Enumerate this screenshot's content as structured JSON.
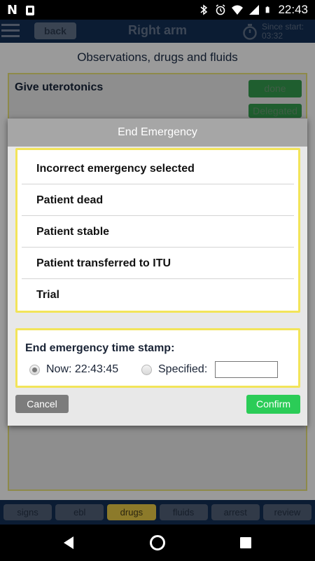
{
  "status_bar": {
    "left_icons": [
      "n-logo-icon",
      "phone-notification-icon"
    ],
    "right_icons": [
      "bluetooth-icon",
      "alarm-icon",
      "wifi-icon",
      "signal-icon",
      "battery-icon"
    ],
    "left_text": "N",
    "time": "22:43"
  },
  "header": {
    "back_label": "back",
    "title": "Right arm",
    "timer_label_line1": "Since start:",
    "timer_label_line2": "03:32"
  },
  "section_title": "Observations, drugs and fluids",
  "card": {
    "title": "Give uterotonics",
    "done_label": "done",
    "delegated_label": "Delegated"
  },
  "modal": {
    "title": "End Emergency",
    "options": [
      "Incorrect emergency selected",
      "Patient dead",
      "Patient stable",
      "Patient transferred to ITU",
      "Trial"
    ],
    "timestamp_label": "End emergency time stamp:",
    "now_label": "Now: 22:43:45",
    "specified_label": "Specified:",
    "specified_value": "",
    "selected_radio": "now",
    "cancel_label": "Cancel",
    "confirm_label": "Confirm"
  },
  "tabs": [
    {
      "label": "signs",
      "active": false
    },
    {
      "label": "ebl",
      "active": false
    },
    {
      "label": "drugs",
      "active": true
    },
    {
      "label": "fluids",
      "active": false
    },
    {
      "label": "arrest",
      "active": false
    },
    {
      "label": "review",
      "active": false
    }
  ],
  "colors": {
    "confirm_green": "#2bcc57",
    "highlight_yellow": "#f2e45a",
    "header_navy": "#0b1c33"
  }
}
